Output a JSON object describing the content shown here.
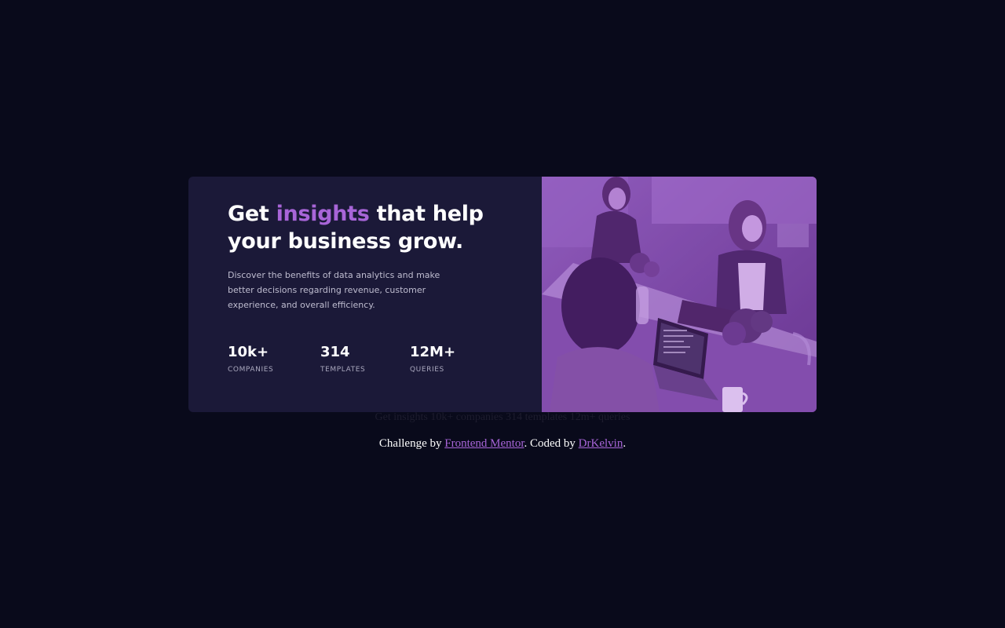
{
  "card": {
    "heading_pre": "Get ",
    "heading_accent": "insights",
    "heading_post": " that help your business grow.",
    "description": "Discover the benefits of data analytics and make better decisions regarding revenue, customer experience, and overall efficiency.",
    "stats": [
      {
        "value": "10k+",
        "label": "COMPANIES"
      },
      {
        "value": "314",
        "label": "TEMPLATES"
      },
      {
        "value": "12M+",
        "label": "QUERIES"
      }
    ],
    "image_alt": "Three women working at a table with laptops"
  },
  "hidden_text": "Get insights 10k+ companies 314 templates 12m+ queries",
  "attribution": {
    "prefix": "Challenge by ",
    "link1": "Frontend Mentor",
    "middle": ". Coded by ",
    "link2": "DrKelvin",
    "suffix": "."
  },
  "colors": {
    "page_bg": "#090a1b",
    "card_bg": "#1b1938",
    "accent": "#a865d8",
    "image_tint": "#6b3a92"
  }
}
